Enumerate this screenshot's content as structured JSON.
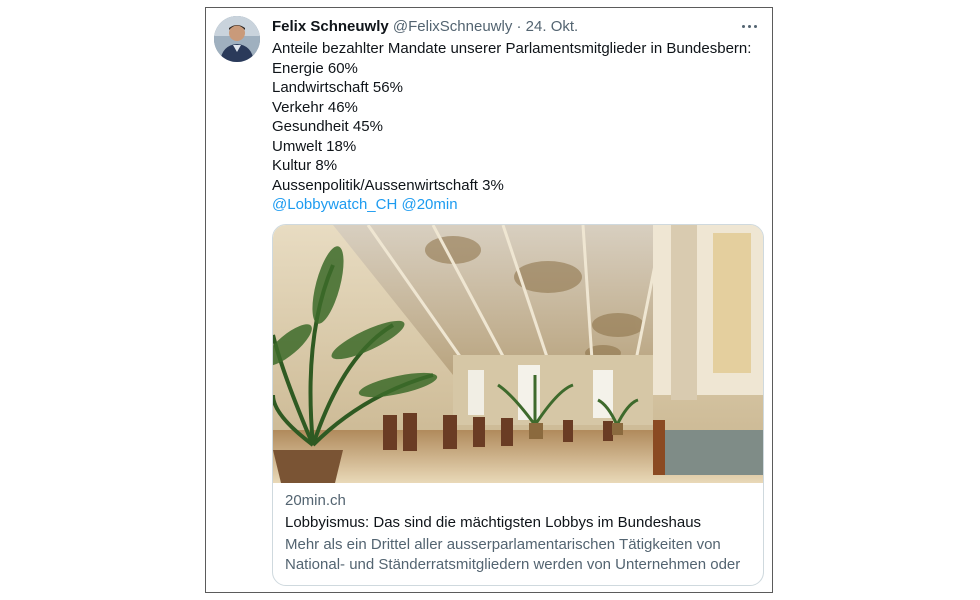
{
  "tweet": {
    "author_name": "Felix Schneuwly",
    "author_handle": "@FelixSchneuwly",
    "separator": "·",
    "date": "24. Okt.",
    "more_icon": "more-horizontal-icon",
    "intro": "Anteile bezahlter Mandate unserer Parlamentsmitglieder in Bundesbern:",
    "lines": [
      "Energie 60%",
      "Landwirtschaft 56%",
      "Verkehr 46%",
      "Gesundheit 45%",
      "Umwelt 18%",
      "Kultur 8%",
      "Aussenpolitik/Aussenwirtschaft 3%"
    ],
    "mentions": [
      "@Lobbywatch_CH",
      "@20min"
    ],
    "link_color": "#1d9bf0"
  },
  "card": {
    "domain": "20min.ch",
    "title": "Lobbyismus: Das sind die mächtigsten Lobbys im Bundeshaus",
    "description_line1": "Mehr als ein Drittel aller ausserparlamentarischen Tätigkeiten von",
    "description_line2": "National- und Ständerratsmitgliedern werden von Unternehmen oder ..."
  }
}
